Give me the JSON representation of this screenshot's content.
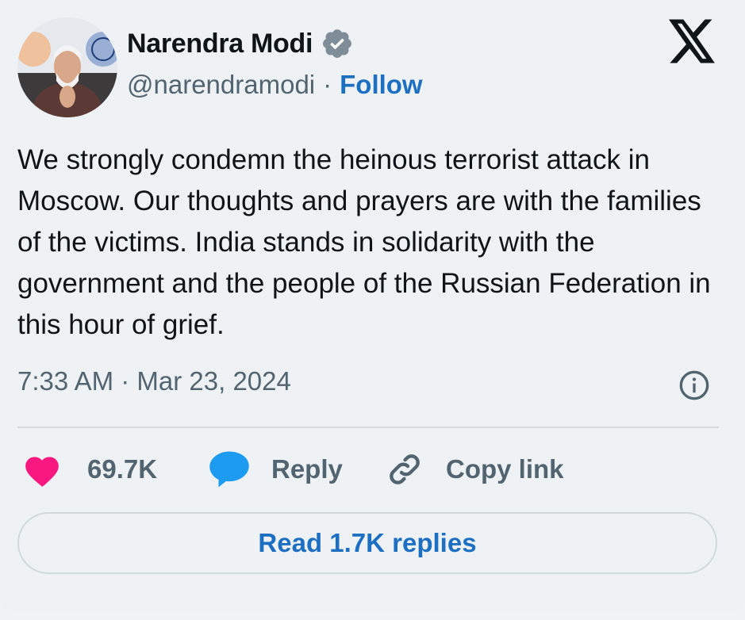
{
  "author": {
    "name": "Narendra Modi",
    "handle": "@narendramodi",
    "separator": "·",
    "follow_label": "Follow",
    "verified_icon": "verified-badge-icon",
    "avatar_icon": "profile-avatar"
  },
  "brand": {
    "logo_icon": "x-logo-icon"
  },
  "tweet": {
    "text": "We strongly condemn the heinous terrorist attack in Moscow. Our thoughts and prayers are with the families of the victims. India stands in solidarity with the government and the people of the Russian Federation in this hour of grief.",
    "timestamp": "7:33 AM · Mar 23, 2024",
    "info_icon": "info-icon"
  },
  "actions": {
    "like_count": "69.7K",
    "reply_label": "Reply",
    "copy_label": "Copy link"
  },
  "footer": {
    "read_replies_label": "Read 1.7K replies"
  },
  "colors": {
    "accent": "#1d6fc2",
    "like": "#f91880",
    "reply": "#1d9bf0",
    "muted": "#536471",
    "background": "#eef2f5"
  }
}
